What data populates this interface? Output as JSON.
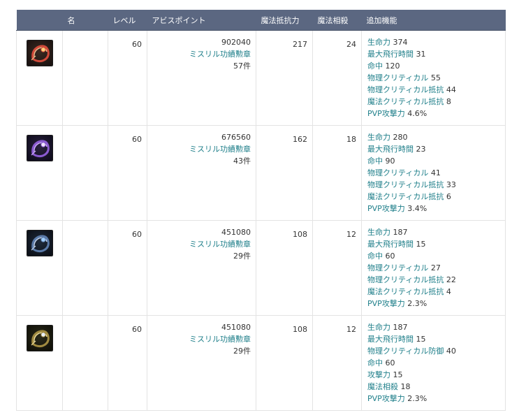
{
  "columns": {
    "icon": "",
    "name": "名",
    "level": "レベル",
    "ap": "アビスポイント",
    "mres": "魔法抵抗力",
    "msup": "魔法相殺",
    "effects": "追加機能"
  },
  "colors": {
    "header_bg": "#5b6781",
    "link_teal": "#1f7f8a",
    "border": "#e3e3e3"
  },
  "rows": [
    {
      "icon": "wing-icon-red",
      "name": "",
      "level": "60",
      "ap": "902040",
      "medal": "ミスリル功績勲章",
      "medal_count": "57件",
      "mres": "217",
      "msup": "24",
      "effects": [
        {
          "name": "生命力",
          "value": "374"
        },
        {
          "name": "最大飛行時間",
          "value": "31"
        },
        {
          "name": "命中",
          "value": "120"
        },
        {
          "name": "物理クリティカル",
          "value": "55"
        },
        {
          "name": "物理クリティカル抵抗",
          "value": "44"
        },
        {
          "name": "魔法クリティカル抵抗",
          "value": "8"
        },
        {
          "name": "PVP攻撃力",
          "value": "4.6%"
        }
      ]
    },
    {
      "icon": "wing-icon-purple",
      "name": "",
      "level": "60",
      "ap": "676560",
      "medal": "ミスリル功績勲章",
      "medal_count": "43件",
      "mres": "162",
      "msup": "18",
      "effects": [
        {
          "name": "生命力",
          "value": "280"
        },
        {
          "name": "最大飛行時間",
          "value": "23"
        },
        {
          "name": "命中",
          "value": "90"
        },
        {
          "name": "物理クリティカル",
          "value": "41"
        },
        {
          "name": "物理クリティカル抵抗",
          "value": "33"
        },
        {
          "name": "魔法クリティカル抵抗",
          "value": "6"
        },
        {
          "name": "PVP攻撃力",
          "value": "3.4%"
        }
      ]
    },
    {
      "icon": "wing-icon-blue",
      "name": "",
      "level": "60",
      "ap": "451080",
      "medal": "ミスリル功績勲章",
      "medal_count": "29件",
      "mres": "108",
      "msup": "12",
      "effects": [
        {
          "name": "生命力",
          "value": "187"
        },
        {
          "name": "最大飛行時間",
          "value": "15"
        },
        {
          "name": "命中",
          "value": "60"
        },
        {
          "name": "物理クリティカル",
          "value": "27"
        },
        {
          "name": "物理クリティカル抵抗",
          "value": "22"
        },
        {
          "name": "魔法クリティカル抵抗",
          "value": "4"
        },
        {
          "name": "PVP攻撃力",
          "value": "2.3%"
        }
      ]
    },
    {
      "icon": "wing-icon-gold",
      "name": "",
      "level": "60",
      "ap": "451080",
      "medal": "ミスリル功績勲章",
      "medal_count": "29件",
      "mres": "108",
      "msup": "12",
      "effects": [
        {
          "name": "生命力",
          "value": "187"
        },
        {
          "name": "最大飛行時間",
          "value": "15"
        },
        {
          "name": "物理クリティカル防御",
          "value": "40"
        },
        {
          "name": "命中",
          "value": "60"
        },
        {
          "name": "攻撃力",
          "value": "15"
        },
        {
          "name": "魔法相殺",
          "value": "18"
        },
        {
          "name": "PVP攻撃力",
          "value": "2.3%"
        }
      ]
    }
  ]
}
